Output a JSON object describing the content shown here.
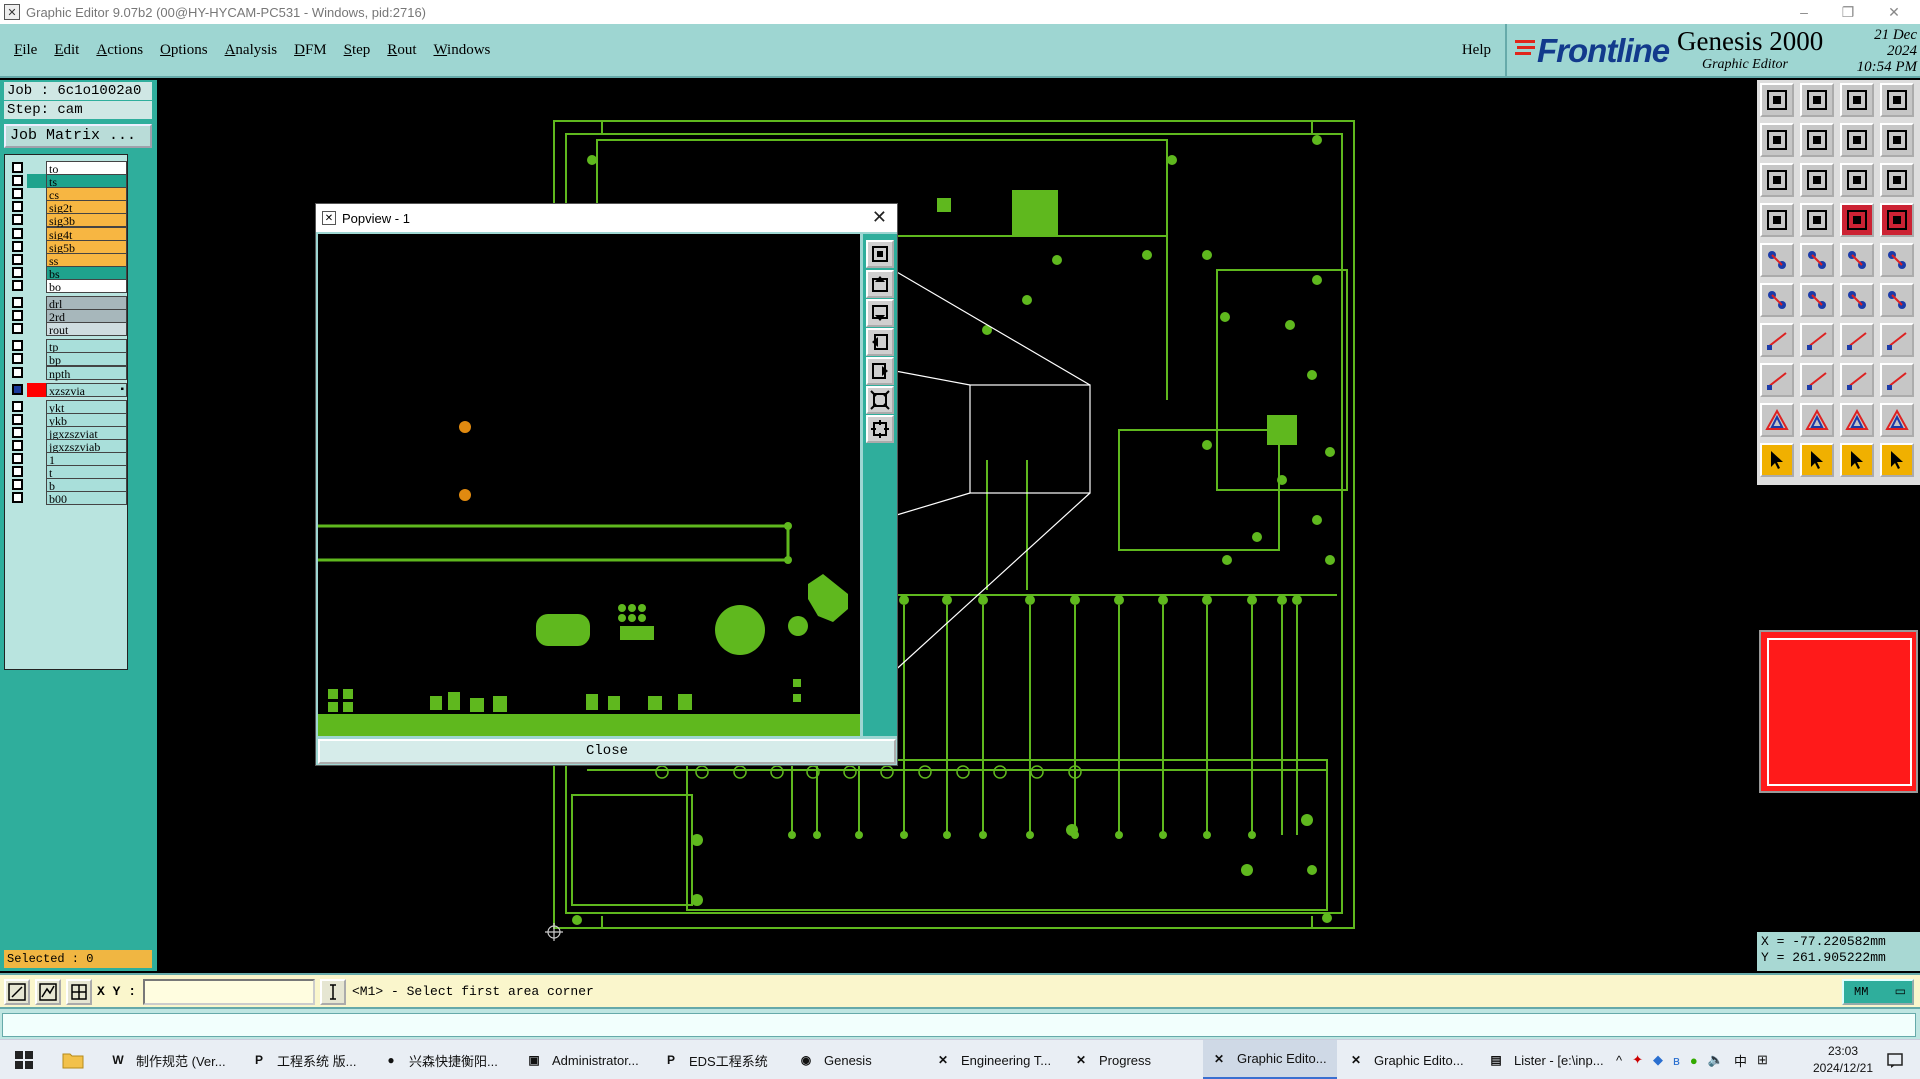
{
  "window": {
    "title": "Graphic Editor 9.07b2 (00@HY-HYCAM-PC531 - Windows, pid:2716)",
    "controls": [
      "–",
      "❐",
      "✕"
    ]
  },
  "menubar": {
    "items": [
      "File",
      "Edit",
      "Actions",
      "Options",
      "Analysis",
      "DFM",
      "Step",
      "Rout",
      "Windows"
    ],
    "help": "Help"
  },
  "brand": {
    "logo": "Frontline",
    "product": "Genesis 2000",
    "subtitle": "Graphic Editor",
    "date": "21 Dec 2024",
    "time": "10:54 PM"
  },
  "job": {
    "job_line": "Job : 6c1o1002a0",
    "step_line": "Step: cam",
    "matrix_button": "Job Matrix ..."
  },
  "layers": [
    {
      "name": "to",
      "color": "#ffffff",
      "checked": true,
      "swatch": ""
    },
    {
      "name": "ts",
      "color": "#1fa38d",
      "checked": true,
      "swatch": "#1fa38d"
    },
    {
      "name": "cs",
      "color": "#f7b642",
      "checked": true,
      "swatch": ""
    },
    {
      "name": "sig2t",
      "color": "#f7b642",
      "checked": true,
      "swatch": ""
    },
    {
      "name": "sig3b",
      "color": "#f7b642",
      "checked": true,
      "swatch": ""
    },
    {
      "name": "sig4t",
      "color": "#f7b642",
      "checked": true,
      "swatch": ""
    },
    {
      "name": "sig5b",
      "color": "#f7b642",
      "checked": true,
      "swatch": ""
    },
    {
      "name": "ss",
      "color": "#f7b642",
      "checked": true,
      "swatch": ""
    },
    {
      "name": "bs",
      "color": "#1fa38d",
      "checked": true,
      "swatch": ""
    },
    {
      "name": "bo",
      "color": "#ffffff",
      "checked": true,
      "swatch": ""
    },
    {
      "name": "drl",
      "color": "#a7b7bb",
      "checked": true,
      "swatch": ""
    },
    {
      "name": "2rd",
      "color": "#a7b7bb",
      "checked": true,
      "swatch": ""
    },
    {
      "name": "rout",
      "color": "#cfdde0",
      "checked": true,
      "swatch": ""
    },
    {
      "name": "tp",
      "color": "#a9dfda",
      "checked": true,
      "swatch": ""
    },
    {
      "name": "bp",
      "color": "#a9dfda",
      "checked": true,
      "swatch": ""
    },
    {
      "name": "npth",
      "color": "#a9dfda",
      "checked": true,
      "swatch": ""
    },
    {
      "name": "xzszvia",
      "color": "#a9dfda",
      "checked": true,
      "swatch": "#ff0000",
      "work": true
    },
    {
      "name": "ykt",
      "color": "#a9dfda",
      "checked": true,
      "swatch": ""
    },
    {
      "name": "ykb",
      "color": "#a9dfda",
      "checked": true,
      "swatch": ""
    },
    {
      "name": "jgxzszviat",
      "color": "#a9dfda",
      "checked": true,
      "swatch": ""
    },
    {
      "name": "jgxzszviab",
      "color": "#a9dfda",
      "checked": true,
      "swatch": ""
    },
    {
      "name": "1",
      "color": "#a9dfda",
      "checked": true,
      "swatch": ""
    },
    {
      "name": "t",
      "color": "#a9dfda",
      "checked": true,
      "swatch": ""
    },
    {
      "name": "b",
      "color": "#a9dfda",
      "checked": true,
      "swatch": ""
    },
    {
      "name": "b00",
      "color": "#a9dfda",
      "checked": true,
      "swatch": ""
    }
  ],
  "selected": "Selected : 0",
  "popview": {
    "title": "Popview - 1",
    "close_label": "Close",
    "close_icon": "close-icon"
  },
  "coords": {
    "x": "X = -77.220582mm",
    "y": "Y = 261.905222mm"
  },
  "statusbar": {
    "xy_label": "X Y :",
    "xy_value": "",
    "prompt": "<M1> - Select first area corner",
    "units": "MM"
  },
  "taskbar": {
    "items": [
      {
        "label": "制作规范 (Ver...",
        "icon": "W"
      },
      {
        "label": "工程系统  版...",
        "icon": "P"
      },
      {
        "label": "兴森快捷衡阳...",
        "icon": "●"
      },
      {
        "label": "Administrator...",
        "icon": "▣"
      },
      {
        "label": "EDS工程系统",
        "icon": "P"
      },
      {
        "label": "Genesis",
        "icon": "◉"
      },
      {
        "label": "Engineering T...",
        "icon": "✕"
      },
      {
        "label": "Progress",
        "icon": "✕"
      },
      {
        "label": "Graphic Edito...",
        "icon": "✕",
        "active": true
      },
      {
        "label": "Graphic Edito...",
        "icon": "✕"
      },
      {
        "label": "Lister - [e:\\inp...",
        "icon": "▤"
      }
    ],
    "tray_lang": "中",
    "clock_time": "23:03",
    "clock_date": "2024/12/21"
  },
  "colors": {
    "panel_teal": "#2fae9c",
    "menu_teal": "#9ed6d2",
    "pcb_green": "#5fb81e",
    "overview_red": "#ff1a1a",
    "highlight_orange": "#f0b000"
  }
}
